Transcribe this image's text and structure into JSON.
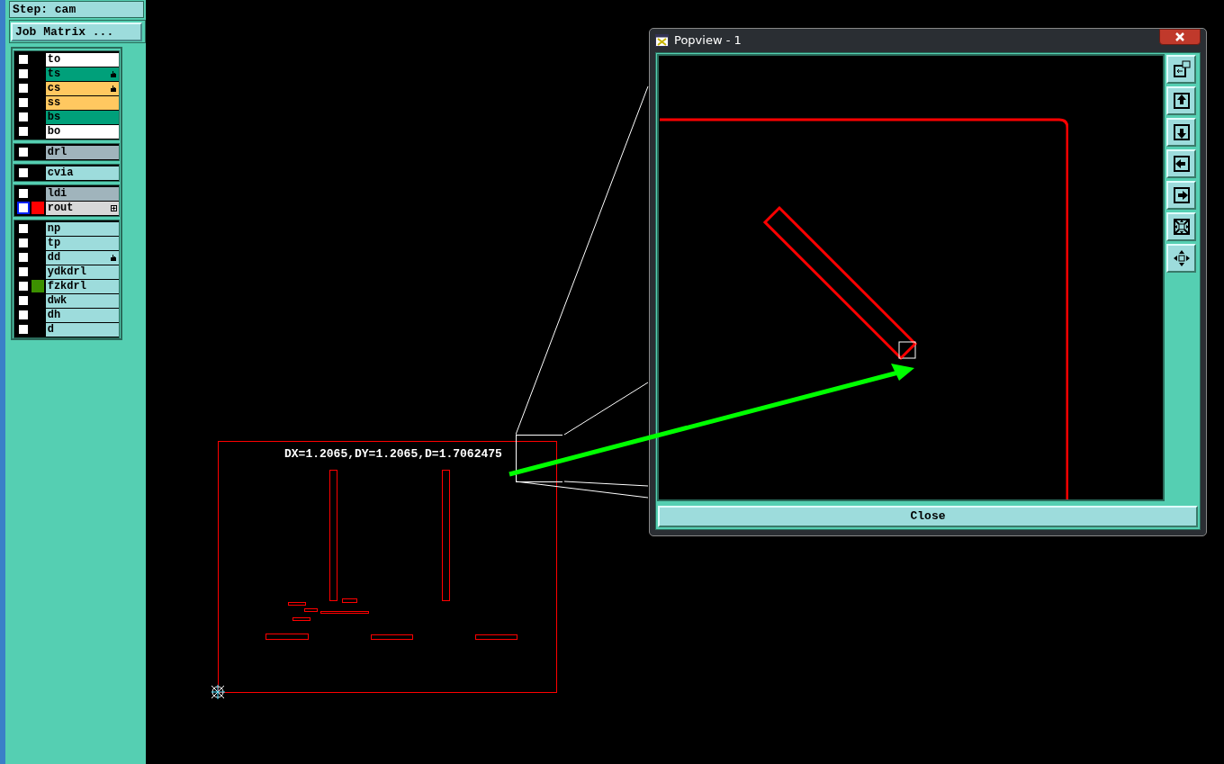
{
  "step_label": "Step: cam",
  "job_matrix_button": "Job Matrix ...",
  "layer_groups": [
    {
      "layers": [
        {
          "name": "to",
          "color": "#ffffff",
          "checked": false,
          "selected": false
        },
        {
          "name": "ts",
          "color": "#00a07a",
          "checked": false,
          "selected": false,
          "marker": {
            "kind": "hand"
          }
        },
        {
          "name": "cs",
          "color": "#ffc860",
          "checked": false,
          "selected": false,
          "marker": {
            "kind": "hand"
          }
        },
        {
          "name": "ss",
          "color": "#ffc860",
          "checked": false,
          "selected": false
        },
        {
          "name": "bs",
          "color": "#00a07a",
          "checked": false,
          "selected": false
        },
        {
          "name": "bo",
          "color": "#ffffff",
          "checked": false,
          "selected": false
        }
      ]
    },
    {
      "layers": [
        {
          "name": "drl",
          "color": "#a0b4bc",
          "checked": false,
          "selected": false
        }
      ]
    },
    {
      "layers": [
        {
          "name": "cvia",
          "color": "#9ddcdc",
          "checked": false,
          "selected": false
        }
      ]
    },
    {
      "layers": [
        {
          "name": "ldi",
          "color": "#a0b4bc",
          "checked": false,
          "selected": false
        },
        {
          "name": "rout",
          "color": "#d8d8d8",
          "checked": false,
          "selected": true,
          "swatch": {
            "color": "#ff0000"
          },
          "marker": {
            "kind": "expand"
          }
        }
      ]
    },
    {
      "layers": [
        {
          "name": "np",
          "color": "#9ddcdc",
          "checked": false,
          "selected": false
        },
        {
          "name": "tp",
          "color": "#9ddcdc",
          "checked": false,
          "selected": false
        },
        {
          "name": "dd",
          "color": "#9ddcdc",
          "checked": false,
          "selected": false,
          "marker": {
            "kind": "hand"
          }
        },
        {
          "name": "ydkdrl",
          "color": "#9ddcdc",
          "checked": false,
          "selected": false
        },
        {
          "name": "fzkdrl",
          "color": "#9ddcdc",
          "checked": false,
          "selected": false,
          "swatch": {
            "color": "#3c9000"
          }
        },
        {
          "name": "dwk",
          "color": "#9ddcdc",
          "checked": false,
          "selected": false
        },
        {
          "name": "dh",
          "color": "#9ddcdc",
          "checked": false,
          "selected": false
        },
        {
          "name": "d",
          "color": "#9ddcdc",
          "checked": false,
          "selected": false
        }
      ]
    }
  ],
  "measurement": "DX=1.2065,DY=1.2065,D=1.7062475",
  "popview": {
    "title": "Popview - 1",
    "close_button": "Close"
  }
}
